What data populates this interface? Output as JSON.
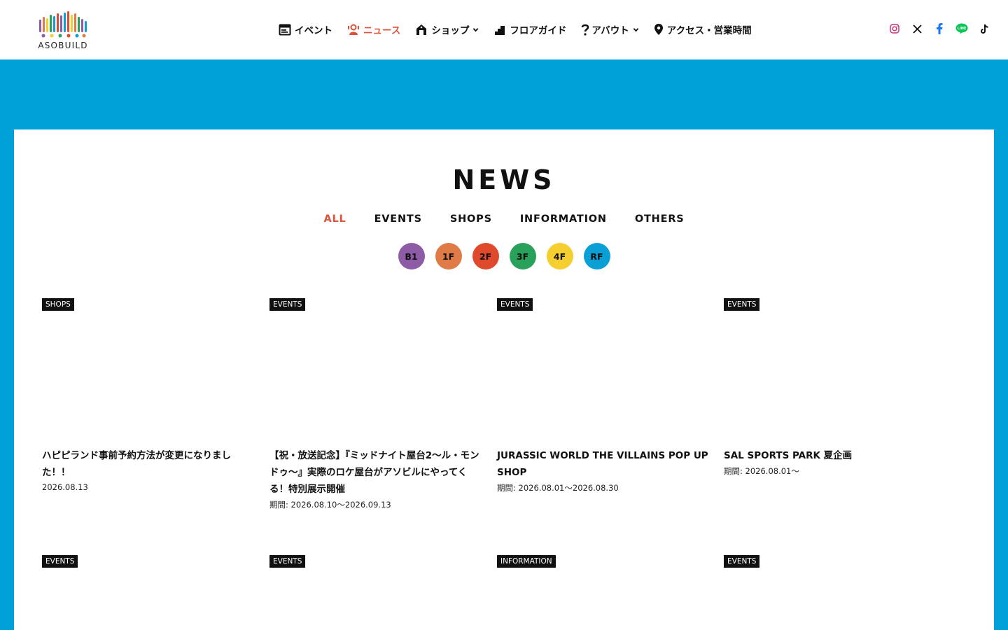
{
  "brand": {
    "logo_text": "ASOBUILD"
  },
  "nav": {
    "items": [
      {
        "label": "イベント",
        "icon": "calendar-icon",
        "dropdown": false,
        "active": false
      },
      {
        "label": "ニュース",
        "icon": "news-person-icon",
        "dropdown": false,
        "active": true
      },
      {
        "label": "ショップ",
        "icon": "shop-icon",
        "dropdown": true,
        "active": false
      },
      {
        "label": "フロアガイド",
        "icon": "floor-stairs-icon",
        "dropdown": false,
        "active": false
      },
      {
        "label": "アバウト",
        "icon": "question-icon",
        "dropdown": true,
        "active": false
      },
      {
        "label": "アクセス・営業時間",
        "icon": "map-pin-icon",
        "dropdown": false,
        "active": false
      }
    ]
  },
  "social": [
    "instagram-icon",
    "x-icon",
    "facebook-icon",
    "line-icon",
    "tiktok-icon"
  ],
  "page": {
    "title": "NEWS",
    "tabs": [
      {
        "label": "ALL",
        "active": true
      },
      {
        "label": "EVENTS",
        "active": false
      },
      {
        "label": "SHOPS",
        "active": false
      },
      {
        "label": "INFORMATION",
        "active": false
      },
      {
        "label": "OTHERS",
        "active": false
      }
    ],
    "floors": [
      {
        "label": "B1",
        "color": "#8e5ba6"
      },
      {
        "label": "1F",
        "color": "#e07b48"
      },
      {
        "label": "2F",
        "color": "#e04a2c"
      },
      {
        "label": "3F",
        "color": "#2aa15a"
      },
      {
        "label": "4F",
        "color": "#f4cf2f"
      },
      {
        "label": "RF",
        "color": "#0aa0d6"
      }
    ]
  },
  "news": [
    {
      "tag": "SHOPS",
      "title": "ハピピランド事前予約方法が変更になりました！！",
      "date": "2026.08.13"
    },
    {
      "tag": "EVENTS",
      "title": "【祝・放送記念】『ミッドナイト屋台2〜ル・モンドゥ〜』実際のロケ屋台がアソビルにやってくる！特別展示開催",
      "date": "期間: 2026.08.10～2026.09.13"
    },
    {
      "tag": "EVENTS",
      "title": "JURASSIC WORLD THE VILLAINS POP UP SHOP",
      "date": "期間: 2026.08.01～2026.08.30"
    },
    {
      "tag": "EVENTS",
      "title": "SAL SPORTS PARK 夏企画",
      "date": "期間: 2026.08.01～"
    },
    {
      "tag": "EVENTS",
      "title": "",
      "date": ""
    },
    {
      "tag": "EVENTS",
      "title": "",
      "date": ""
    },
    {
      "tag": "INFORMATION",
      "title": "",
      "date": ""
    },
    {
      "tag": "EVENTS",
      "title": "",
      "date": ""
    }
  ],
  "colors": {
    "accent": "#d9543a",
    "background": "#00a1d8"
  }
}
